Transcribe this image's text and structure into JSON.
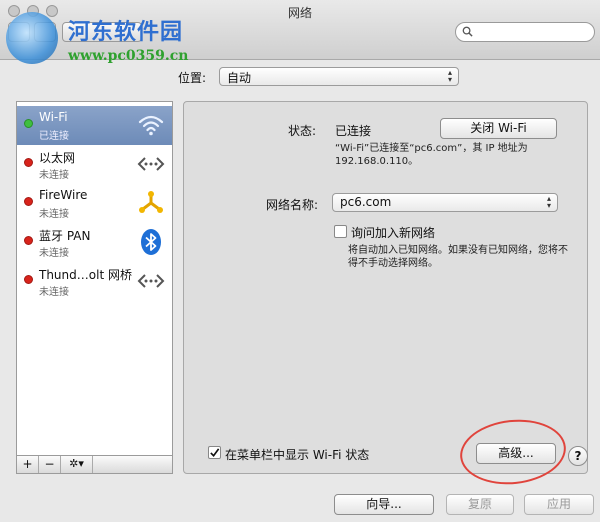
{
  "window": {
    "title": "网络"
  },
  "watermark": {
    "title": "河东软件园",
    "url": "www.pc0359.cn"
  },
  "location": {
    "label": "位置:",
    "value": "自动"
  },
  "services": [
    {
      "name": "Wi-Fi",
      "status": "已连接",
      "dot_color": "#3fbf3f",
      "icon": "wifi-icon",
      "selected": true
    },
    {
      "name": "以太网",
      "status": "未连接",
      "dot_color": "#d8231b",
      "icon": "ethernet-icon",
      "selected": false
    },
    {
      "name": "FireWire",
      "status": "未连接",
      "dot_color": "#d8231b",
      "icon": "firewire-icon",
      "selected": false
    },
    {
      "name": "蓝牙 PAN",
      "status": "未连接",
      "dot_color": "#d8231b",
      "icon": "bluetooth-icon",
      "selected": false
    },
    {
      "name": "Thund…olt 网桥",
      "status": "未连接",
      "dot_color": "#d8231b",
      "icon": "thunderbolt-bridge-icon",
      "selected": false
    }
  ],
  "sidebar_buttons": {
    "add": "+",
    "remove": "−",
    "gear": "✲▾"
  },
  "detail": {
    "status_label": "状态:",
    "status_value": "已连接",
    "turn_off_button": "关闭 Wi-Fi",
    "status_desc_line1": "“Wi-Fi”已连接至“pc6.com”，其 IP 地址为",
    "status_desc_line2": "192.168.0.110。",
    "network_name_label": "网络名称:",
    "network_name_value": "pc6.com",
    "ask_join_label": "询问加入新网络",
    "ask_join_desc_line1": "将自动加入已知网络。如果没有已知网络，您将不",
    "ask_join_desc_line2": "得不手动选择网络。",
    "show_in_menubar_label": "在菜单栏中显示 Wi-Fi 状态",
    "advanced_button": "高级...",
    "help_button": "?"
  },
  "footer": {
    "assist_button": "向导...",
    "revert_button": "复原",
    "apply_button": "应用"
  },
  "colors": {
    "annotation_circle": "#e0443c",
    "connected": "#3fbf3f",
    "disconnected": "#d8231b"
  }
}
